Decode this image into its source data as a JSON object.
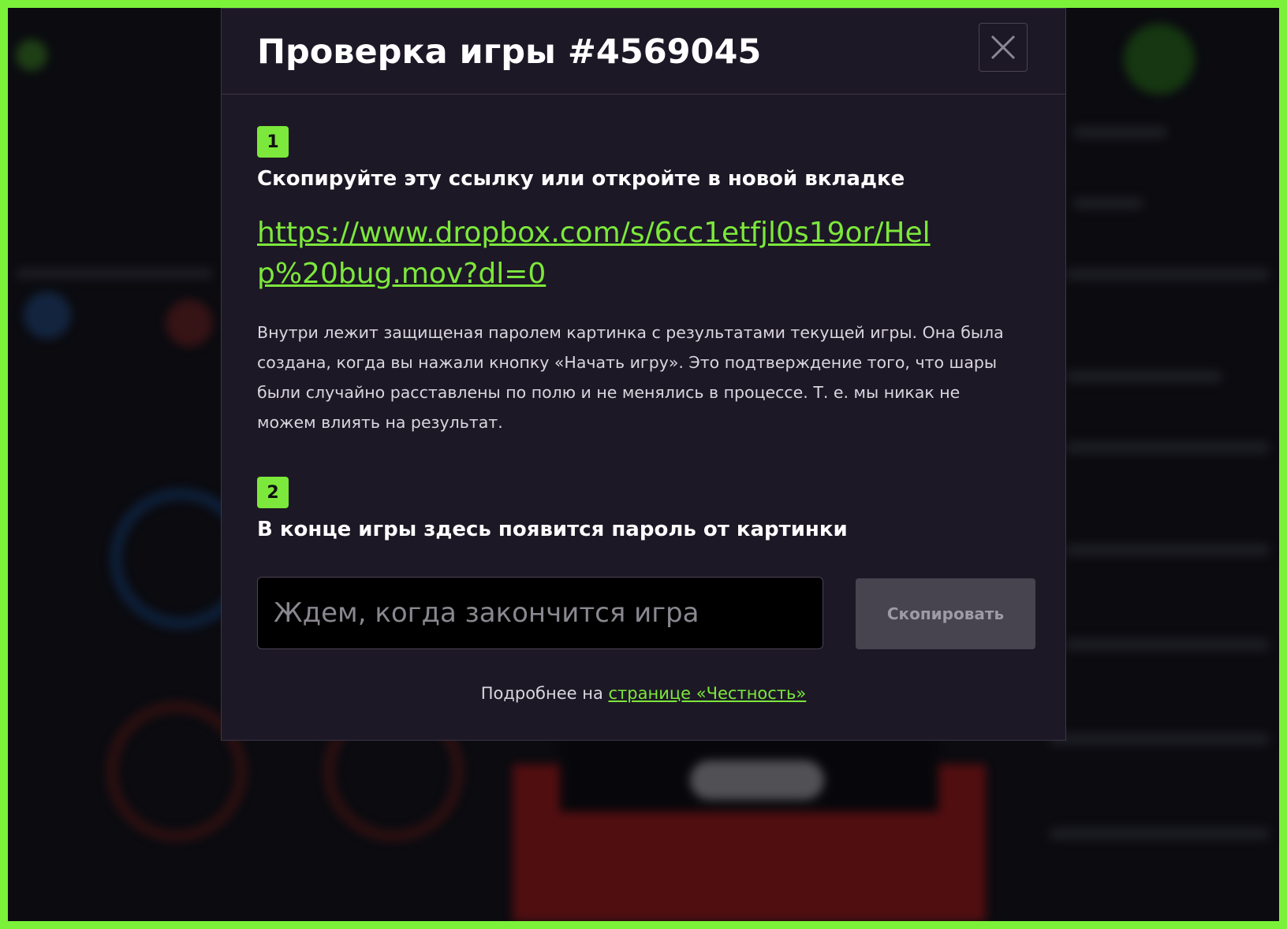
{
  "modal": {
    "title": "Проверка игры #4569045",
    "close_label": "×",
    "step1": {
      "number": "1",
      "heading": "Скопируйте эту ссылку или откройте в новой вкладке",
      "link": "https://www.dropbox.com/s/6cc1etfjl0s19or/Help%20bug.mov?dl=0",
      "description": "Внутри лежит защищеная паролем картинка с результатами текущей игры. Она была создана, когда вы нажали кнопку «Начать игру». Это подтверждение того, что шары были случайно расставлены по полю и не менялись в процессе. Т. е. мы никак не можем влиять на результат."
    },
    "step2": {
      "number": "2",
      "heading": "В конце игры здесь появится пароль от картинки",
      "input_value": "",
      "input_placeholder": "Ждем, когда закончится игра",
      "copy_button": "Скопировать"
    },
    "footer": {
      "prefix": "Подробнее на ",
      "link_text": "странице «Честность»"
    }
  },
  "colors": {
    "accent": "#7ce83b",
    "modal_bg": "#1d1826",
    "frame_border": "#7cf13a"
  },
  "icons": {
    "close": "close-icon"
  }
}
